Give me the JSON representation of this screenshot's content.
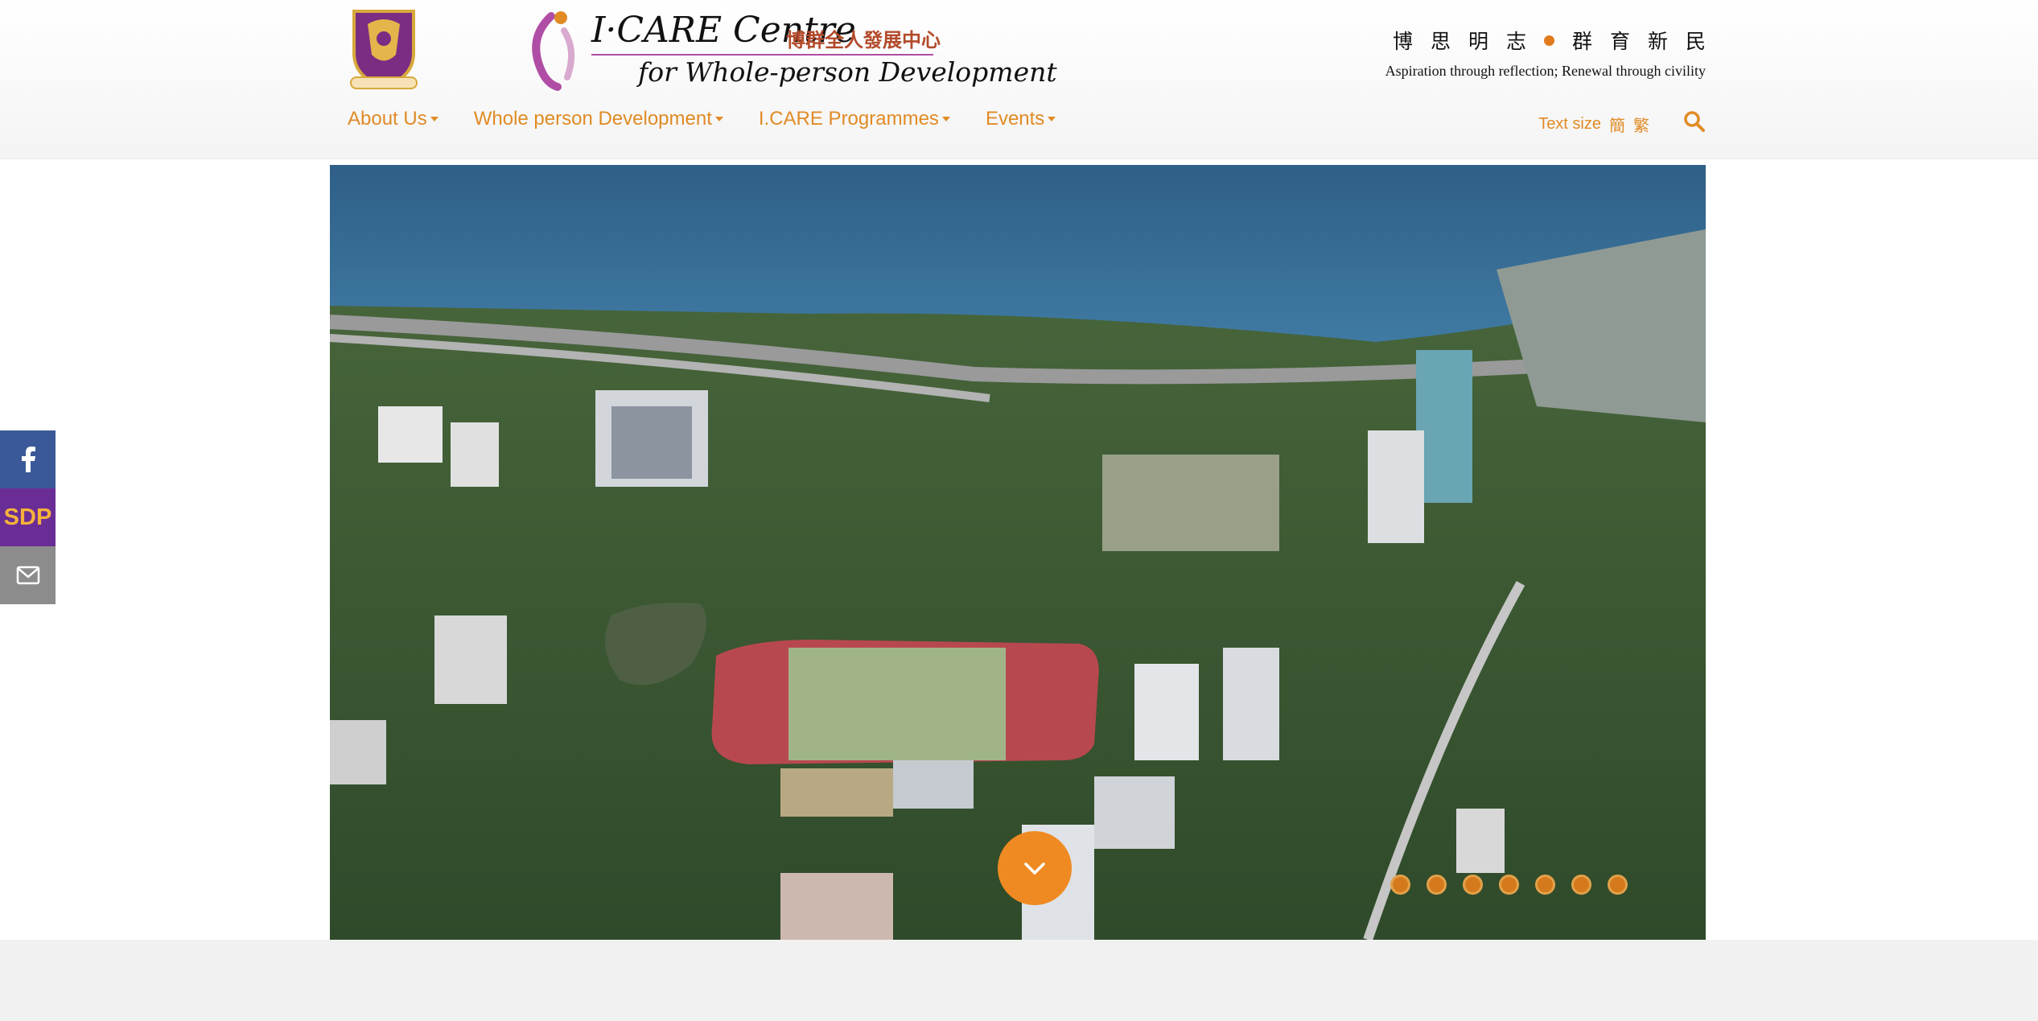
{
  "header": {
    "logo_alt_cuhk": "CUHK crest",
    "logo_icare_en_line1": "I·CARE Centre",
    "logo_icare_cn": "博群全人發展中心",
    "logo_icare_en_line2": "for Whole-person Development",
    "motto_cn_left": "博思明志",
    "motto_cn_right": "群育新民",
    "motto_en": "Aspiration through reflection; Renewal through civility"
  },
  "nav": {
    "items": [
      {
        "label": "About Us"
      },
      {
        "label": "Whole person Development"
      },
      {
        "label": "I.CARE Programmes"
      },
      {
        "label": "Events"
      }
    ],
    "textsize_label": "Text size",
    "lang_simplified": "簡",
    "lang_traditional": "繁"
  },
  "side": {
    "sdp_label": "SDP"
  },
  "colors": {
    "accent": "#e08b25",
    "button": "#ef8a22",
    "facebook": "#3b5998",
    "sdp": "#6a2d95",
    "mail": "#8c8c8c"
  },
  "carousel": {
    "slide_count": 7
  },
  "icons": [
    "facebook-icon",
    "mail-icon",
    "search-icon",
    "chevron-down-icon"
  ]
}
